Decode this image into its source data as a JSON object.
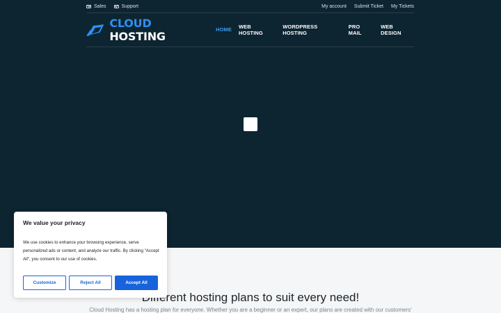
{
  "topbar": {
    "left": [
      {
        "icon": "mail-icon",
        "label": "Sales"
      },
      {
        "icon": "mail-icon",
        "label": "Support"
      }
    ],
    "right": [
      "My account",
      "Submit Ticket",
      "My Tickets"
    ]
  },
  "header": {
    "logo": {
      "word1": "CLOUD",
      "word2": " HOSTING",
      "accent": "#2f8ff0"
    },
    "nav": [
      {
        "label": "HOME",
        "active": true
      },
      {
        "label": "WEB HOSTING"
      },
      {
        "label": "WORDPRESS HOSTING"
      },
      {
        "label": "PRO MAIL"
      },
      {
        "label": "WEB DESIGN"
      }
    ]
  },
  "section": {
    "title": "Different hosting plans to suit every need!",
    "subtitle": "Cloud Hosting has a hosting plan for everyone. Whether you are a beginner or an expert, our plans are created with our customers'"
  },
  "cookie": {
    "title": "We value your privacy",
    "body": "We use cookies to enhance your browsing experience, serve personalized ads or content, and analyze our traffic. By clicking \"Accept All\", you consent to our use of cookies.",
    "customize": "Customize",
    "reject": "Reject All",
    "accept": "Accept All",
    "accent": "#1863dc"
  },
  "colors": {
    "hero_bg": "#0d2431",
    "nav_active": "#3d9bf0"
  }
}
